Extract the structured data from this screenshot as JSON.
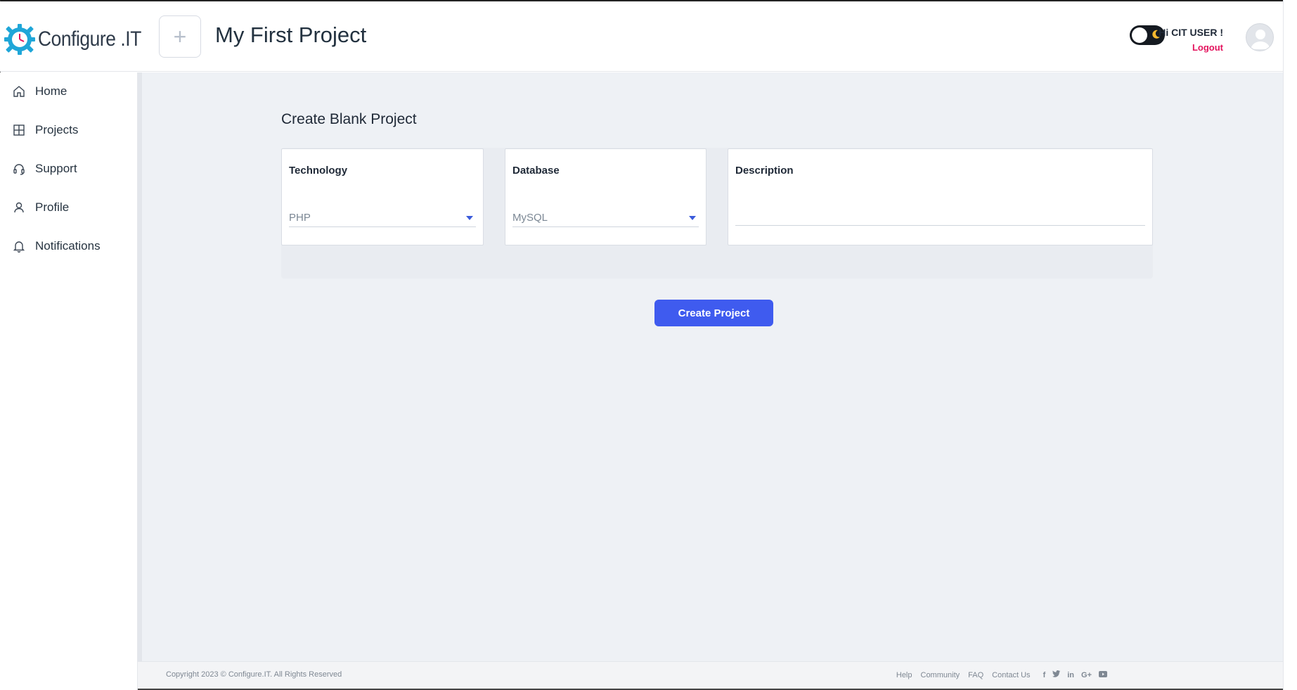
{
  "app": {
    "name": "Configure.IT",
    "logo_text": "Configure .IT"
  },
  "header": {
    "add_symbol": "+",
    "project_title": "My First Project",
    "greeting": "Hi CIT USER !",
    "logout": "Logout"
  },
  "sidebar": {
    "items": [
      {
        "label": "Home",
        "icon": "home-icon"
      },
      {
        "label": "Projects",
        "icon": "grid-icon"
      },
      {
        "label": "Support",
        "icon": "headset-icon"
      },
      {
        "label": "Profile",
        "icon": "user-icon"
      },
      {
        "label": "Notifications",
        "icon": "bell-icon"
      }
    ]
  },
  "main": {
    "section_title": "Create Blank Project",
    "technology": {
      "label": "Technology",
      "value": "PHP"
    },
    "database": {
      "label": "Database",
      "value": "MySQL"
    },
    "description": {
      "label": "Description",
      "value": ""
    },
    "create_button": "Create Project"
  },
  "footer": {
    "copyright": "Copyright 2023 © Configure.IT. All Rights Reserved",
    "links": [
      "Help",
      "Community",
      "FAQ",
      "Contact Us"
    ],
    "social": [
      "facebook-icon",
      "twitter-icon",
      "linkedin-icon",
      "google-plus-icon",
      "youtube-icon"
    ]
  },
  "colors": {
    "accent": "#3f5bef",
    "logout": "#e3135d",
    "logo_gear": "#1fa6d8",
    "main_bg": "#eef1f5"
  }
}
